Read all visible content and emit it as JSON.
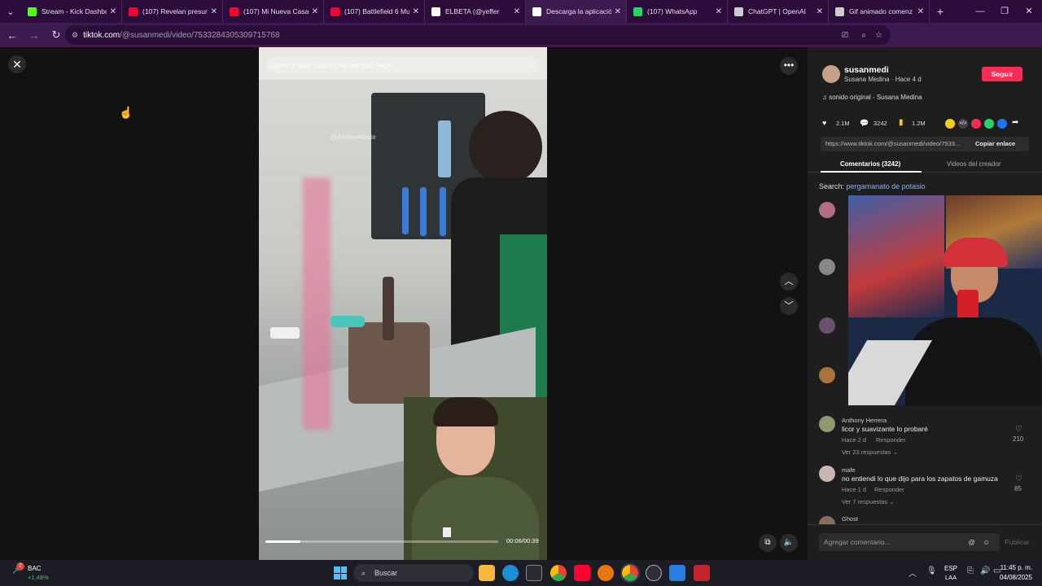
{
  "browser": {
    "tabs": [
      {
        "label": "Stream - Kick Dashbo",
        "icon": "kick-icon",
        "color": "#53fc18"
      },
      {
        "label": "(107) Revelan presunt",
        "icon": "youtube-icon",
        "color": "#ff0033"
      },
      {
        "label": "(107) Mi Nueva Casa",
        "icon": "youtube-icon",
        "color": "#ff0033"
      },
      {
        "label": "(107) Battlefield 6 Mu",
        "icon": "youtube-icon",
        "color": "#ff0033"
      },
      {
        "label": "ELBETA (@yeffer",
        "icon": "tiktok-icon",
        "color": "#ffffff"
      },
      {
        "label": "Descarga la aplicació",
        "icon": "tiktok-icon",
        "color": "#ffffff"
      },
      {
        "label": "(107) WhatsApp",
        "icon": "whatsapp-icon",
        "color": "#25d366"
      },
      {
        "label": "ChatGPT | OpenAI",
        "icon": "openai-icon",
        "color": "#cccccc"
      },
      {
        "label": "Gif animado comenz",
        "icon": "globe-icon",
        "color": "#cccccc"
      }
    ],
    "url_host": "tiktok.com",
    "url_path": "/@susanmedi/video/7533284305309715768"
  },
  "video": {
    "search_hint": "cómo limpiar zapatos de gamuza negro",
    "watermark": "@AndresAlzate",
    "time": "00:06/00:39",
    "progress": 0.15
  },
  "post": {
    "username": "susanmedi",
    "display": "Susana Medina · Hace 4 d",
    "follow_label": "Seguir",
    "sound": "sonido original - Susana Medina",
    "likes": "2.1M",
    "comments_count": "3242",
    "saves": "1.2M",
    "link": "https://www.tiktok.com/@susanmedi/video/7533...",
    "copy_label": "Copiar enlace",
    "tab_comments": "Comentarios (3242)",
    "tab_creator": "Videos del creador",
    "search_prefix": "Search:",
    "search_term": "pergamanato de potasio"
  },
  "comments": [
    {
      "author": "Anthony Herrera",
      "text": "licor y suavizante lo probaré",
      "time": "Hace 2 d",
      "reply": "Responder",
      "likes": "210",
      "replies": "Ver 23 respuestas"
    },
    {
      "author": "mafe",
      "text": "no entiendi lo que dijo para los zapatos de gamuza",
      "time": "Hace 1 d",
      "reply": "Responder",
      "likes": "85",
      "replies": "Ver 7 respuestas"
    },
    {
      "author": "Ghost"
    }
  ],
  "composer": {
    "placeholder": "Agregar comentario...",
    "post_label": "Publicar"
  },
  "taskbar": {
    "stock_name": "BAC",
    "stock_change": "+1,48%",
    "search_label": "Buscar",
    "lang": "ESP",
    "lang2": "LAA",
    "time": "11:45 p. m.",
    "date": "04/08/2025"
  }
}
